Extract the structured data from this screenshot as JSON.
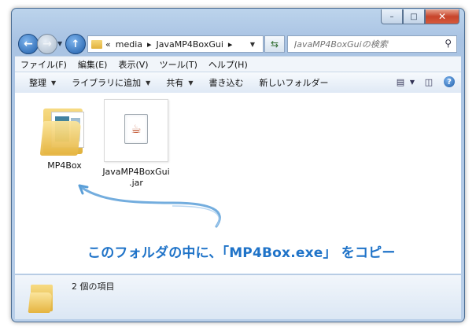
{
  "window": {
    "min_label": "–",
    "max_label": "□",
    "close_label": "✕"
  },
  "nav": {
    "back_icon": "←",
    "fwd_icon": "→",
    "up_icon": "↑",
    "address": [
      "«",
      "media",
      "▸",
      "JavaMP4BoxGui",
      "▸"
    ],
    "refresh_icon": "⇆",
    "search_placeholder": "JavaMP4BoxGuiの検索"
  },
  "menubar": [
    "ファイル(F)",
    "編集(E)",
    "表示(V)",
    "ツール(T)",
    "ヘルプ(H)"
  ],
  "commands": {
    "organize": "整理",
    "library": "ライブラリに追加",
    "share": "共有",
    "burn": "書き込む",
    "new_folder": "新しいフォルダー"
  },
  "items": [
    {
      "name": "MP4Box",
      "type": "folder"
    },
    {
      "name_line1": "JavaMP4BoxGui",
      "name_line2": ".jar",
      "type": "jar"
    }
  ],
  "annotation": "このフォルダの中に、「MP4Box.exe」 をコピー",
  "details": {
    "count": "2 個の項目"
  },
  "colors": {
    "annotation": "#1f73c8",
    "accent": "#1d5ca8"
  }
}
